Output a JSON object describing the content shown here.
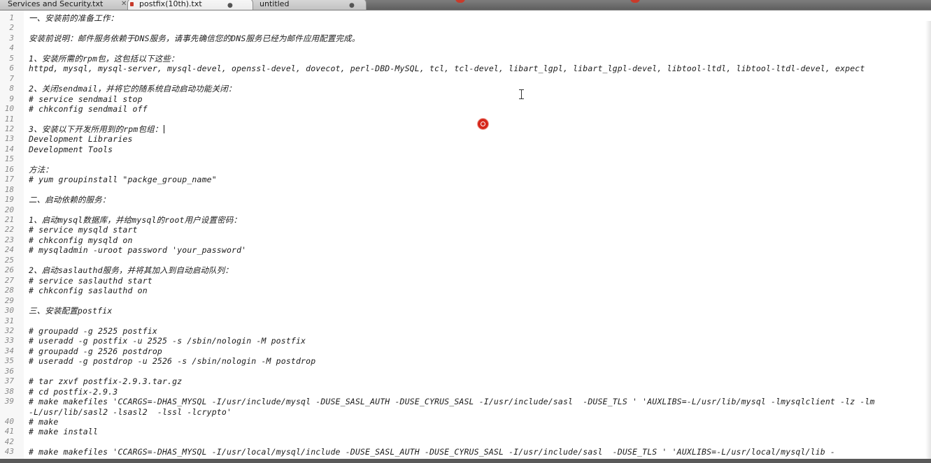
{
  "tabs": [
    {
      "label": "Services and Security.txt",
      "close": "✕"
    },
    {
      "label": "postfix(10th).txt",
      "dot": "●"
    },
    {
      "label": "untitled",
      "dot": "●"
    }
  ],
  "lines": [
    {
      "n": "1",
      "text": "一、安装前的准备工作："
    },
    {
      "n": "2",
      "text": ""
    },
    {
      "n": "3",
      "text": "安装前说明：邮件服务依赖于DNS服务，请事先确信您的DNS服务已经为邮件应用配置完成。"
    },
    {
      "n": "4",
      "text": ""
    },
    {
      "n": "5",
      "text": "1、安装所需的rpm包，这包括以下这些："
    },
    {
      "n": "6",
      "text": "httpd, mysql, mysql-server, mysql-devel, openssl-devel, dovecot, perl-DBD-MySQL, tcl, tcl-devel, libart_lgpl, libart_lgpl-devel, libtool-ltdl, libtool-ltdl-devel, expect"
    },
    {
      "n": "7",
      "text": ""
    },
    {
      "n": "8",
      "text": "2、关闭sendmail，并将它的随系统自动启动功能关闭："
    },
    {
      "n": "9",
      "text": "# service sendmail stop"
    },
    {
      "n": "10",
      "text": "# chkconfig sendmail off"
    },
    {
      "n": "11",
      "text": ""
    },
    {
      "n": "12",
      "text": "3、安装以下开发所用到的rpm包组："
    },
    {
      "n": "13",
      "text": "Development Libraries"
    },
    {
      "n": "14",
      "text": "Development Tools"
    },
    {
      "n": "15",
      "text": ""
    },
    {
      "n": "16",
      "text": "方法："
    },
    {
      "n": "17",
      "text": "# yum groupinstall \"packge_group_name\""
    },
    {
      "n": "18",
      "text": ""
    },
    {
      "n": "19",
      "text": "二、启动依赖的服务："
    },
    {
      "n": "20",
      "text": ""
    },
    {
      "n": "21",
      "text": "1、启动mysql数据库，并给mysql的root用户设置密码："
    },
    {
      "n": "22",
      "text": "# service mysqld start"
    },
    {
      "n": "23",
      "text": "# chkconfig mysqld on"
    },
    {
      "n": "24",
      "text": "# mysqladmin -uroot password 'your_password'"
    },
    {
      "n": "25",
      "text": ""
    },
    {
      "n": "26",
      "text": "2、启动saslauthd服务，并将其加入到自动启动队列："
    },
    {
      "n": "27",
      "text": "# service saslauthd start"
    },
    {
      "n": "28",
      "text": "# chkconfig saslauthd on"
    },
    {
      "n": "29",
      "text": ""
    },
    {
      "n": "30",
      "text": "三、安装配置postfix"
    },
    {
      "n": "31",
      "text": ""
    },
    {
      "n": "32",
      "text": "# groupadd -g 2525 postfix"
    },
    {
      "n": "33",
      "text": "# useradd -g postfix -u 2525 -s /sbin/nologin -M postfix"
    },
    {
      "n": "34",
      "text": "# groupadd -g 2526 postdrop"
    },
    {
      "n": "35",
      "text": "# useradd -g postdrop -u 2526 -s /sbin/nologin -M postdrop"
    },
    {
      "n": "36",
      "text": ""
    },
    {
      "n": "37",
      "text": "# tar zxvf postfix-2.9.3.tar.gz"
    },
    {
      "n": "38",
      "text": "# cd postfix-2.9.3"
    },
    {
      "n": "39",
      "text": "# make makefiles 'CCARGS=-DHAS_MYSQL -I/usr/include/mysql -DUSE_SASL_AUTH -DUSE_CYRUS_SASL -I/usr/include/sasl  -DUSE_TLS ' 'AUXLIBS=-L/usr/lib/mysql -lmysqlclient -lz -lm"
    },
    {
      "n": "",
      "text": "-L/usr/lib/sasl2 -lsasl2  -lssl -lcrypto'"
    },
    {
      "n": "40",
      "text": "# make"
    },
    {
      "n": "41",
      "text": "# make install"
    },
    {
      "n": "42",
      "text": ""
    },
    {
      "n": "43",
      "text": "# make makefiles 'CCARGS=-DHAS_MYSQL -I/usr/local/mysql/include -DUSE_SASL_AUTH -DUSE_CYRUS_SASL -I/usr/include/sasl  -DUSE_TLS ' 'AUXLIBS=-L/usr/local/mysql/lib -"
    }
  ]
}
